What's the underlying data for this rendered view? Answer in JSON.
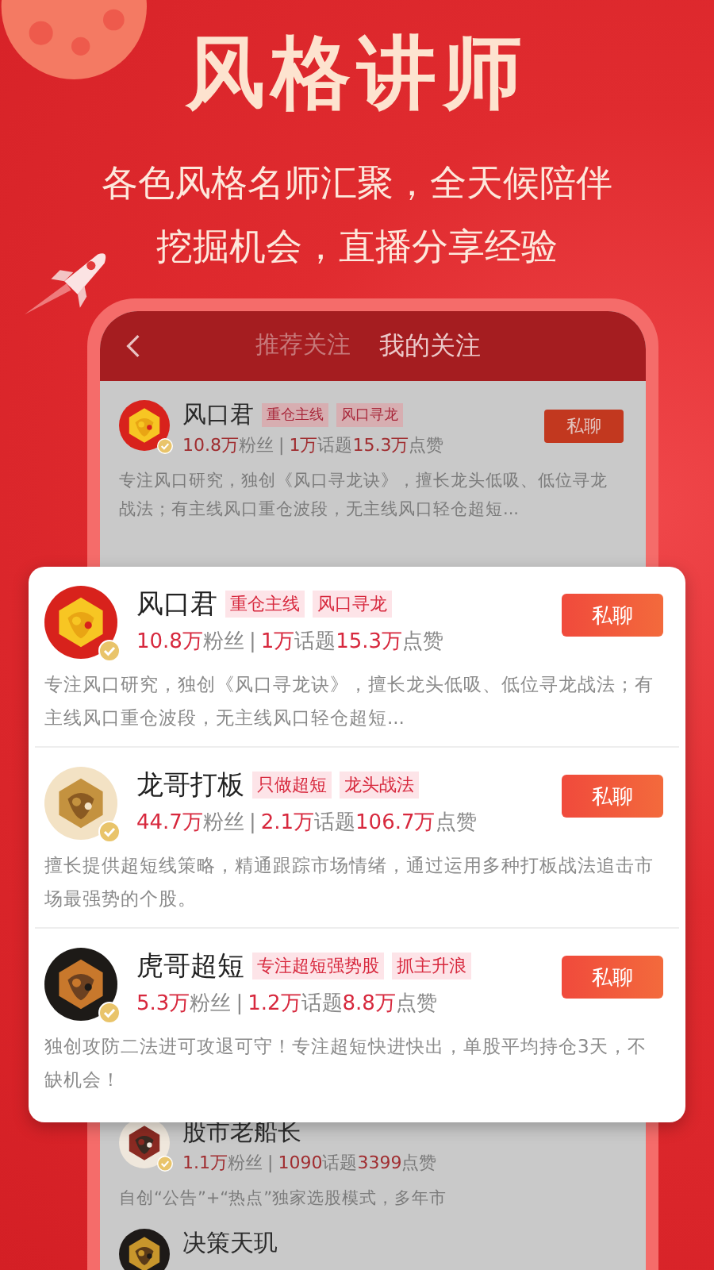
{
  "headline": "风格讲师",
  "subtitle_lines": [
    "各色风格名师汇聚，全天候陪伴",
    "挖掘机会，直播分享经验"
  ],
  "phone": {
    "tabs": [
      {
        "label": "推荐关注",
        "selected": false
      },
      {
        "label": "我的关注",
        "selected": true
      }
    ],
    "list": [
      {
        "name": "风口君",
        "tags": [
          "重仓主线",
          "风口寻龙"
        ],
        "stats": [
          {
            "value": "10.8万",
            "unit": "粉丝"
          },
          {
            "value": "1万",
            "unit": "话题"
          },
          {
            "value": "15.3万",
            "unit": "点赞"
          }
        ],
        "separator": "|",
        "description": "专注风口研究，独创《风口寻龙诀》，擅长龙头低吸、低位寻龙战法；有主线风口重仓波段，无主线风口轻仓超短...",
        "button": "私聊",
        "verified": true
      },
      {
        "name": "股市老船长",
        "stats": [
          {
            "value": "1.1万",
            "unit": "粉丝"
          },
          {
            "value": "1090",
            "unit": "话题"
          },
          {
            "value": "3399",
            "unit": "点赞"
          }
        ],
        "separator": "|",
        "description": "自创“公告”+“热点”独家选股模式，多年市",
        "verified": true
      },
      {
        "name": "决策天玑"
      }
    ]
  },
  "card": {
    "teachers": [
      {
        "name": "风口君",
        "tags": [
          "重仓主线",
          "风口寻龙"
        ],
        "stats": [
          {
            "value": "10.8万",
            "unit": "粉丝"
          },
          {
            "value": "1万",
            "unit": "话题"
          },
          {
            "value": "15.3万",
            "unit": "点赞"
          }
        ],
        "separator": "|",
        "description": "专注风口研究，独创《风口寻龙诀》，擅长龙头低吸、低位寻龙战法；有主线风口重仓波段，无主线风口轻仓超短...",
        "button": "私聊",
        "verified": true
      },
      {
        "name": "龙哥打板",
        "tags": [
          "只做超短",
          "龙头战法"
        ],
        "stats": [
          {
            "value": "44.7万",
            "unit": "粉丝"
          },
          {
            "value": "2.1万",
            "unit": "话题"
          },
          {
            "value": "106.7万",
            "unit": "点赞"
          }
        ],
        "separator": "|",
        "description": "擅长提供超短线策略，精通跟踪市场情绪，通过运用多种打板战法追击市场最强势的个股。",
        "button": "私聊",
        "verified": true
      },
      {
        "name": "虎哥超短",
        "tags": [
          "专注超短强势股",
          "抓主升浪"
        ],
        "stats": [
          {
            "value": "5.3万",
            "unit": "粉丝"
          },
          {
            "value": "1.2万",
            "unit": "话题"
          },
          {
            "value": "8.8万",
            "unit": "点赞"
          }
        ],
        "separator": "|",
        "description": "独创攻防二法进可攻退可守！专注超短快进快出，单股平均持仓3天，不缺机会！",
        "button": "私聊",
        "verified": true
      }
    ]
  }
}
